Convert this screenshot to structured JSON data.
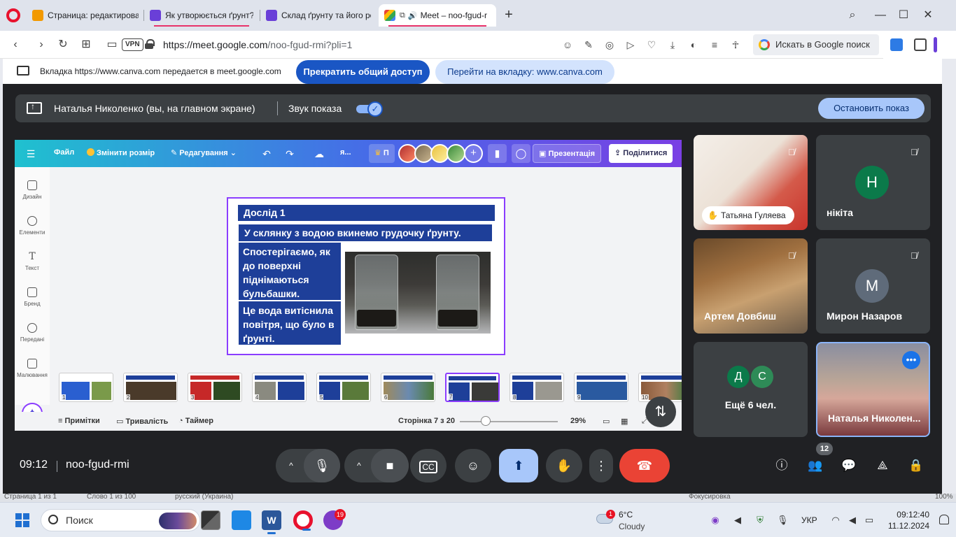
{
  "browser": {
    "tabs": [
      {
        "title": "Страница: редактирован",
        "favicon_color": "#f29900"
      },
      {
        "title": "Як утворюється ґрунт? –",
        "favicon_color": "#6a3fd8"
      },
      {
        "title": "Склад ґрунту та його род",
        "favicon_color": "#6a3fd8"
      },
      {
        "title": "Meet – noo-fgud-r",
        "favicon_color": "#00897b"
      }
    ],
    "new_tab": "+",
    "url_host": "https://meet.google.com",
    "url_path": "/noo-fgud-rmi?pli=1",
    "vpn_label": "VPN",
    "google_search": "Искать в Google поиск"
  },
  "share_banner": {
    "text": "Вкладка https://www.canva.com передается в meet.google.com",
    "stop_button": "Прекратить общий доступ",
    "goto_button": "Перейти на вкладку: www.canva.com"
  },
  "meet": {
    "presenter_text": "Наталья Николенко (вы, на главном экране)",
    "sound_label": "Звук показа",
    "stop_presenting": "Остановить показ",
    "time": "09:12",
    "meeting_code": "noo-fgud-rmi",
    "participants_count": "12",
    "participants": [
      {
        "name": "Татьяна Гуляева",
        "type": "video"
      },
      {
        "name": "нікіта",
        "initial": "Н",
        "color": "#0b7a4a"
      },
      {
        "name": "Артем Довбиш",
        "type": "video"
      },
      {
        "name": "Мирон Назаров",
        "initial": "М",
        "color": "#5f6b7a"
      },
      {
        "name": "Ещё 6 чел.",
        "initials": [
          "Д",
          "С"
        ],
        "colors": [
          "#0b7a4a",
          "#2e8b57"
        ]
      },
      {
        "name": "Наталья Николен...",
        "type": "video"
      }
    ]
  },
  "canva": {
    "menu": {
      "file": "Файл",
      "resize": "Змінити розмір",
      "edit": "Редагування",
      "initial": "я...",
      "pro": "П",
      "present": "Презентація",
      "share": "Поділитися"
    },
    "sidebar": [
      "Дизайн",
      "Елементи",
      "Текст",
      "Бренд",
      "Передані",
      "Малювання"
    ],
    "slide": {
      "title": "Дослід 1",
      "subtitle": "У склянку з водою вкинемо грудочку ґрунту.",
      "box1": "Спостерігаємо, як до поверхні піднімаються бульбашки.",
      "box2": "Це вода витіснила повітря, що було в ґрунті."
    },
    "thumb_numbers": [
      "1",
      "2",
      "3",
      "4",
      "5",
      "6",
      "7",
      "8",
      "9",
      "10"
    ],
    "bottom": {
      "notes": "Примітки",
      "duration": "Тривалість",
      "timer": "Таймер",
      "page": "Сторінка 7 з 20",
      "zoom": "29%"
    }
  },
  "word_status": {
    "page": "Страница 1 из 1",
    "words": "Слово 1 из 100",
    "lang": "русский (Украина)",
    "focus": "Фокусировка",
    "zoom": "100%"
  },
  "taskbar": {
    "search": "Поиск",
    "viber_badge": "19",
    "weather_badge": "1",
    "temp": "6°C",
    "condition": "Cloudy",
    "lang": "УКР",
    "time": "09:12:40",
    "date": "11.12.2024"
  }
}
